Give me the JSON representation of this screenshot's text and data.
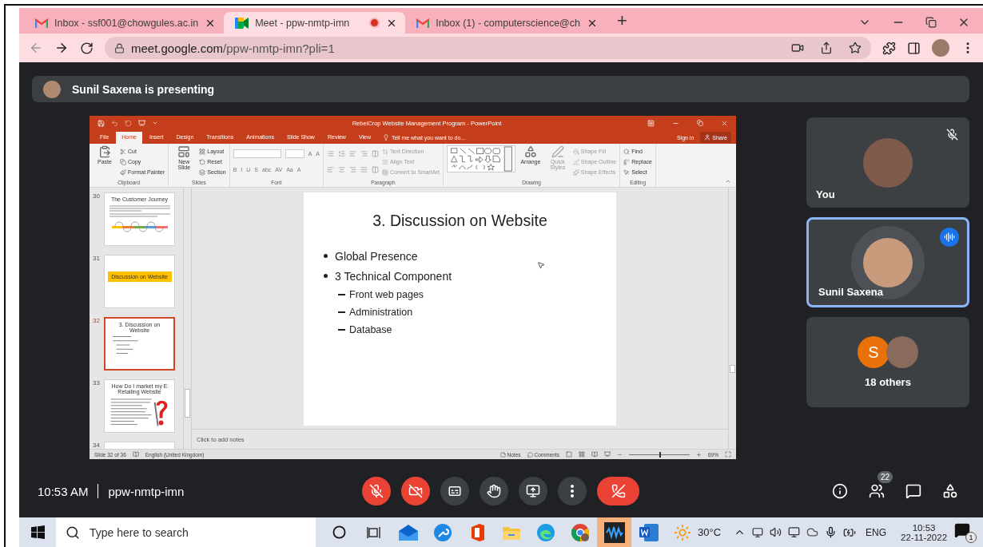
{
  "browser": {
    "tabs": [
      {
        "kind": "mail",
        "title": "Inbox - ssf001@chowgules.ac.in",
        "selected": false,
        "recording": false
      },
      {
        "kind": "meet",
        "title": "Meet - ppw-nmtp-imn",
        "selected": true,
        "recording": true
      },
      {
        "kind": "mail",
        "title": "Inbox (1) - computerscience@ch",
        "selected": false,
        "recording": false
      }
    ],
    "new_tab": "+",
    "url": "meet.google.com/ppw-nmtp-imn?pli=1"
  },
  "meet": {
    "banner": "Sunil Saxena is presenting",
    "presentation": {
      "title": "RebelCrop Website Management Program - PowerPoint",
      "ribbon_tabs": [
        {
          "label": "File",
          "selected": false
        },
        {
          "label": "Home",
          "selected": true
        },
        {
          "label": "Insert",
          "selected": false
        },
        {
          "label": "Design",
          "selected": false
        },
        {
          "label": "Transitions",
          "selected": false
        },
        {
          "label": "Animations",
          "selected": false
        },
        {
          "label": "Slide Show",
          "selected": false
        },
        {
          "label": "Review",
          "selected": false
        },
        {
          "label": "View",
          "selected": false
        }
      ],
      "tell_me": "Tell me what you want to do...",
      "sign_in": "Sign in",
      "share": "Share",
      "groups": [
        {
          "kind": "buttons",
          "label": "Clipboard",
          "bigs": [
            {
              "label": "Paste",
              "kind": "paste",
              "disabled": false
            }
          ],
          "items": [
            {
              "label": "Cut",
              "kind": "cut",
              "disabled": false
            },
            {
              "label": "Copy",
              "kind": "copy",
              "disabled": false
            },
            {
              "label": "Format Painter",
              "kind": "painter",
              "disabled": false
            }
          ]
        },
        {
          "kind": "buttons",
          "label": "Slides",
          "bigs": [
            {
              "label": "New Slide",
              "kind": "new-slide",
              "disabled": false
            }
          ],
          "items": [
            {
              "label": "Layout",
              "kind": "layout",
              "disabled": false
            },
            {
              "label": "Reset",
              "kind": "reset",
              "disabled": false
            },
            {
              "label": "Section",
              "kind": "section",
              "disabled": false
            }
          ]
        },
        {
          "kind": "font",
          "label": "Font",
          "size_tools": [
            "A",
            "A"
          ],
          "tools": [
            "B",
            "I",
            "U",
            "S",
            "abc",
            "AV",
            "Aa",
            "A"
          ]
        },
        {
          "kind": "paragraph",
          "label": "Paragraph",
          "items": [
            {
              "label": "Text Direction",
              "kind": "text-direction",
              "disabled": true
            },
            {
              "label": "Align Text",
              "kind": "align-text",
              "disabled": true
            },
            {
              "label": "Convert to SmartArt",
              "kind": "smartart",
              "disabled": true
            }
          ]
        },
        {
          "kind": "drawing",
          "label": "Drawing",
          "bigs": [
            {
              "label": "Arrange",
              "kind": "arrange",
              "disabled": false
            },
            {
              "label": "Quick Styles",
              "kind": "quick-styles",
              "disabled": true
            }
          ],
          "items": [
            {
              "label": "Shape Fill",
              "kind": "shape-fill",
              "disabled": true
            },
            {
              "label": "Shape Outline",
              "kind": "shape-outline",
              "disabled": true
            },
            {
              "label": "Shape Effects",
              "kind": "shape-effects",
              "disabled": true
            }
          ]
        },
        {
          "kind": "buttons",
          "label": "Editing",
          "items": [
            {
              "label": "Find",
              "kind": "find",
              "disabled": false
            },
            {
              "label": "Replace",
              "kind": "replace",
              "disabled": false
            },
            {
              "label": "Select",
              "kind": "select",
              "disabled": false
            }
          ]
        }
      ],
      "thumbnails": [
        {
          "number": "30",
          "kind": "journey",
          "title": "The Customer Journey",
          "selected": false
        },
        {
          "number": "31",
          "kind": "banner",
          "title": "Discussion on Website",
          "selected": false
        },
        {
          "number": "32",
          "kind": "bullets",
          "title": "3. Discussion on Website",
          "selected": true
        },
        {
          "number": "33",
          "kind": "question",
          "title": "How Do I market my E Retailing Website",
          "selected": false
        },
        {
          "number": "34",
          "kind": "cut",
          "selected": false
        }
      ],
      "slide": {
        "title": "3. Discussion on Website",
        "bullets": [
          {
            "text": "Global Presence"
          },
          {
            "text": "3 Technical Component",
            "children": [
              {
                "text": "Front web pages"
              },
              {
                "text": "Administration"
              },
              {
                "text": "Database"
              }
            ]
          }
        ]
      },
      "notes_placeholder": "Click to add notes",
      "status": {
        "slide": "Slide 32 of 36",
        "language": "English (United Kingdom)",
        "notes": "Notes",
        "comments": "Comments",
        "zoom": {
          "level": 0.5,
          "reading": "69%"
        }
      }
    },
    "participants": [
      {
        "name": "You",
        "muted": true,
        "speaking": false
      },
      {
        "name": "Sunil Saxena",
        "muted": false,
        "speaking": true
      }
    ],
    "others": {
      "initial": "S",
      "label": "18 others"
    },
    "time": "10:53 AM",
    "meeting_code": "ppw-nmtp-imn",
    "controls": [
      {
        "kind": "mic",
        "on": false
      },
      {
        "kind": "camera",
        "on": false
      },
      {
        "kind": "captions",
        "on": false
      },
      {
        "kind": "hand",
        "on": false
      },
      {
        "kind": "present",
        "on": false
      },
      {
        "kind": "more",
        "on": false
      },
      {
        "kind": "leave"
      }
    ],
    "people_count": "22"
  },
  "taskbar": {
    "search_placeholder": "Type here to search",
    "apps": [
      {
        "kind": "cortana",
        "selected": false
      },
      {
        "kind": "task-view",
        "selected": false
      },
      {
        "kind": "mail",
        "selected": false
      },
      {
        "kind": "tool",
        "selected": false
      },
      {
        "kind": "office",
        "selected": false
      },
      {
        "kind": "explorer",
        "selected": false
      },
      {
        "kind": "edge",
        "selected": false
      },
      {
        "kind": "chrome",
        "selected": false
      },
      {
        "kind": "waves",
        "selected": true
      },
      {
        "kind": "word",
        "selected": false
      }
    ],
    "weather": "30°C",
    "language": "ENG",
    "time": "10:53",
    "date": "22-11-2022",
    "notifications": "1"
  }
}
